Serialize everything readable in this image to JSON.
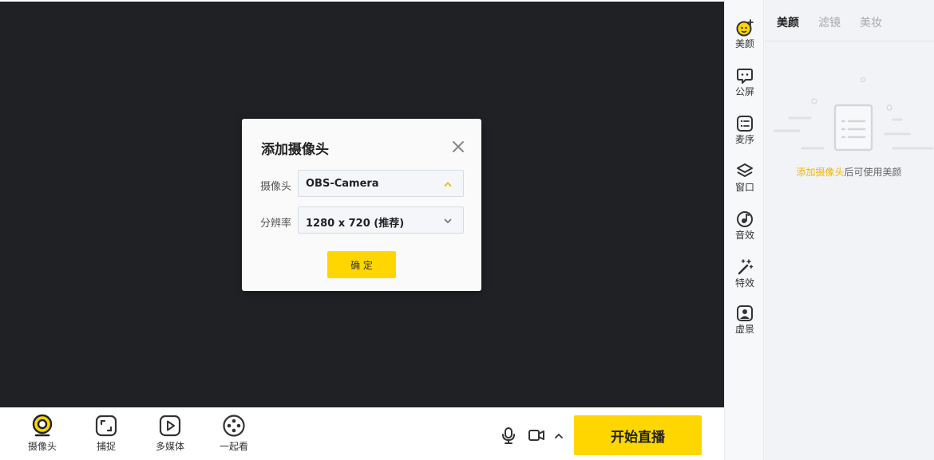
{
  "colors": {
    "accent": "#ffd600",
    "stage_background": "#1f2125",
    "link": "#f2b600"
  },
  "bottom_toolbar": {
    "tools": [
      {
        "label": "摄像头",
        "icon": "camera-icon",
        "active": true
      },
      {
        "label": "捕捉",
        "icon": "capture-icon"
      },
      {
        "label": "多媒体",
        "icon": "media-play-icon"
      },
      {
        "label": "一起看",
        "icon": "film-reel-icon"
      }
    ],
    "controls": [
      {
        "icon": "microphone-icon"
      },
      {
        "icon": "video-camera-icon"
      },
      {
        "icon": "chevron-up-icon"
      }
    ],
    "start_label": "开始直播"
  },
  "rail": {
    "items": [
      {
        "label": "美颜",
        "icon": "beauty-face-icon",
        "active": true
      },
      {
        "label": "公屏",
        "icon": "chat-bubble-icon"
      },
      {
        "label": "麦序",
        "icon": "list-icon"
      },
      {
        "label": "窗口",
        "icon": "layers-icon"
      },
      {
        "label": "音效",
        "icon": "sound-effect-icon"
      },
      {
        "label": "特效",
        "icon": "magic-wand-icon"
      },
      {
        "label": "虚景",
        "icon": "virtual-background-icon"
      }
    ]
  },
  "panel": {
    "tabs": [
      {
        "label": "美颜",
        "active": true
      },
      {
        "label": "滤镜"
      },
      {
        "label": "美妆"
      }
    ],
    "empty_state": {
      "icon": "document-list-icon",
      "link_text": "添加摄像头",
      "rest_text": "后可使用美颜"
    }
  },
  "dialog": {
    "title": "添加摄像头",
    "close_icon": "close-icon",
    "camera_label": "摄像头",
    "camera_value": "OBS-Camera",
    "camera_open": true,
    "resolution_label": "分辨率",
    "resolution_value": "1280 x 720 (推荐)",
    "confirm_label": "确 定"
  }
}
